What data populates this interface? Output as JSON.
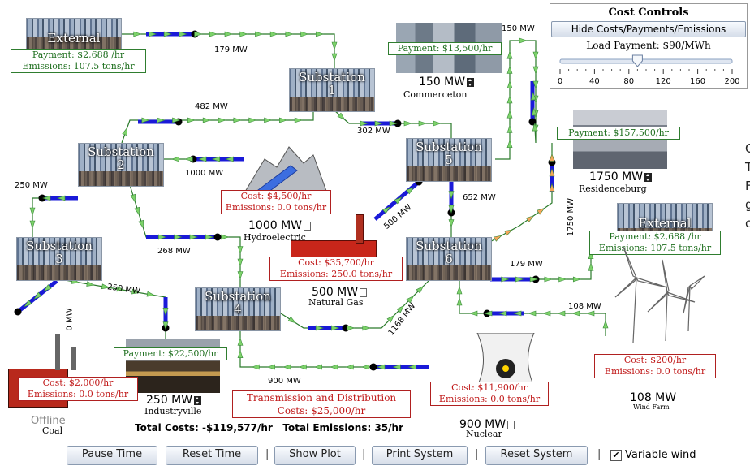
{
  "controls": {
    "title": "Cost Controls",
    "toggle_label": "Hide Costs/Payments/Emissions",
    "load_payment_label": "Load Payment: $90/MWh",
    "slider_value": 90,
    "slider_ticks": [
      "0",
      "40",
      "80",
      "120",
      "160",
      "200"
    ]
  },
  "substations": [
    {
      "label": "Substation",
      "num": "1"
    },
    {
      "label": "Substation",
      "num": "2"
    },
    {
      "label": "Substation",
      "num": "3"
    },
    {
      "label": "Substation",
      "num": "4"
    },
    {
      "label": "Substation",
      "num": "5"
    },
    {
      "label": "Substation",
      "num": "6"
    }
  ],
  "externals": {
    "west": {
      "title": "External",
      "payment": "Payment: $2,688 /hr",
      "emissions": "Emissions: 107.5 tons/hr"
    },
    "east": {
      "title": "External",
      "payment": "Payment: $2,688 /hr",
      "emissions": "Emissions: 107.5 tons/hr"
    }
  },
  "loads": {
    "commerceton": {
      "payment": "Payment: $13,500/hr",
      "mw": "150 MW",
      "name": "Commerceton"
    },
    "residenceburg": {
      "payment": "Payment: $157,500/hr",
      "mw": "1750 MW",
      "name": "Residenceburg"
    },
    "industryville": {
      "payment": "Payment: $22,500/hr",
      "mw": "250 MW",
      "name": "Industryville"
    }
  },
  "generators": {
    "hydro": {
      "cost": "Cost: $4,500/hr",
      "emissions": "Emissions: 0.0 tons/hr",
      "mw": "1000 MW",
      "name": "Hydroelectric"
    },
    "gas": {
      "cost": "Cost: $35,700/hr",
      "emissions": "Emissions: 250.0 tons/hr",
      "mw": "500 MW",
      "name": "Natural Gas"
    },
    "coal": {
      "cost": "Cost: $2,000/hr",
      "emissions": "Emissions: 0.0 tons/hr",
      "status": "Offline",
      "name": "Coal"
    },
    "nuclear": {
      "cost": "Cost: $11,900/hr",
      "emissions": "Emissions: 0.0 tons/hr",
      "mw": "900 MW",
      "name": "Nuclear"
    },
    "wind": {
      "cost": "Cost: $200/hr",
      "emissions": "Emissions: 0.0 tons/hr",
      "mw": "108 MW",
      "name": "Wind Farm"
    }
  },
  "line_flows": {
    "ext_w_s1": "179 MW",
    "s2_s1": "482 MW",
    "s1_s5": "302 MW",
    "com_top": "150 MW",
    "hydro_s2": "1000 MW",
    "s2_s3": "250 MW",
    "s5_s6": "652 MW",
    "gas_s5": "500 MW",
    "res_flow": "1750 MW",
    "s2_s4": "268 MW",
    "s3_ind": "250 MW",
    "coal": "0 MW",
    "s6_ext": "179 MW",
    "s4_s6": "1168 MW",
    "wind_s6": "108 MW",
    "nuc_s4": "900 MW"
  },
  "summary": {
    "td_title": "Transmission and Distribution",
    "td_costs": "Costs: $25,000/hr",
    "total": "Total Costs: -$119,577/hr   Total Emissions: 35/hr"
  },
  "side_text": [
    "C",
    "T",
    "F",
    "g",
    "c"
  ],
  "buttons": {
    "pause": "Pause Time",
    "reset_time": "Reset Time",
    "show_plot": "Show Plot",
    "print": "Print System",
    "reset_system": "Reset System",
    "variable_wind": "Variable wind"
  },
  "colors": {
    "line": "#1a1ad8",
    "arrow_green": "#7dd36a",
    "arrow_orange": "#f5a55a",
    "payment_green": "#1d6e1d",
    "cost_red": "#c01818"
  }
}
